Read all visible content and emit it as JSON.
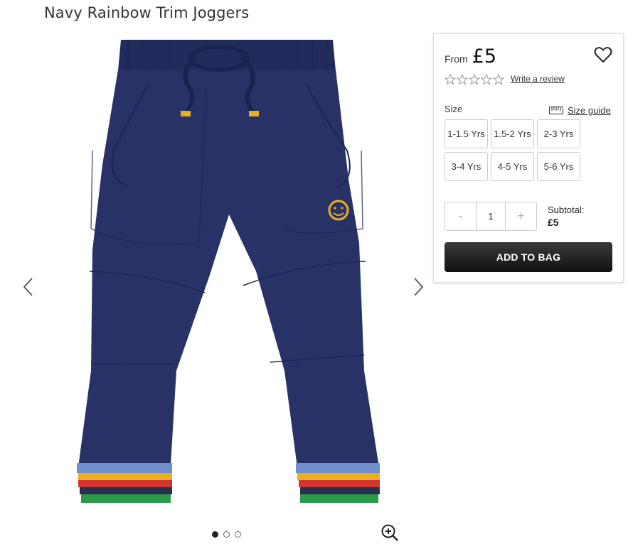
{
  "product": {
    "title": "Navy Rainbow Trim Joggers",
    "image_alt": "product-image"
  },
  "gallery": {
    "slides": 3,
    "active_slide": 1
  },
  "panel": {
    "from_label": "From",
    "price": "£5",
    "rating_stars": 0,
    "rating_max": 5,
    "review_link": "Write a review",
    "size_label": "Size",
    "size_guide": "Size guide",
    "sizes": [
      "1-1.5 Yrs",
      "1.5-2 Yrs",
      "2-3 Yrs",
      "3-4 Yrs",
      "4-5 Yrs",
      "5-6 Yrs"
    ],
    "quantity": {
      "minus": "-",
      "value": "1",
      "plus": "+"
    },
    "subtotal_label": "Subtotal:",
    "subtotal_value": "£5",
    "add_button": "ADD TO BAG"
  },
  "colors": {
    "navy": "#283266",
    "rainbow": [
      "#e8b020",
      "#d1352b",
      "#2b2f4f",
      "#2a9a4a",
      "#6f8fcf"
    ]
  }
}
